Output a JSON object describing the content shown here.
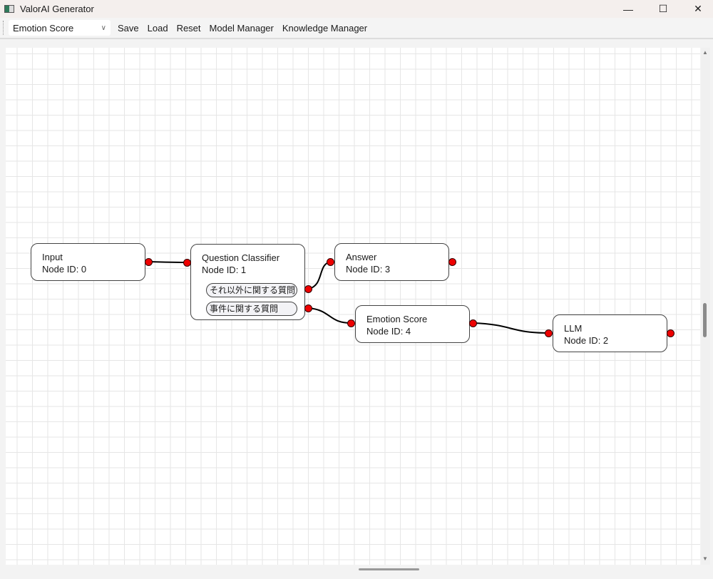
{
  "window": {
    "title": "ValorAI Generator",
    "minimize": "—",
    "maximize": "☐",
    "close": "✕"
  },
  "toolbar": {
    "selected": "Emotion Score",
    "save": "Save",
    "load": "Load",
    "reset": "Reset",
    "model_manager": "Model Manager",
    "knowledge_manager": "Knowledge Manager"
  },
  "nodes": {
    "input": {
      "name": "Input",
      "id": "Node ID: 0"
    },
    "classifier": {
      "name": "Question Classifier",
      "id": "Node ID: 1",
      "classes": [
        "それ以外に関する質問",
        "事件に関する質問"
      ]
    },
    "answer": {
      "name": "Answer",
      "id": "Node ID: 3"
    },
    "emotion": {
      "name": "Emotion Score",
      "id": "Node ID: 4"
    },
    "llm": {
      "name": "LLM",
      "id": "Node ID: 2"
    }
  }
}
